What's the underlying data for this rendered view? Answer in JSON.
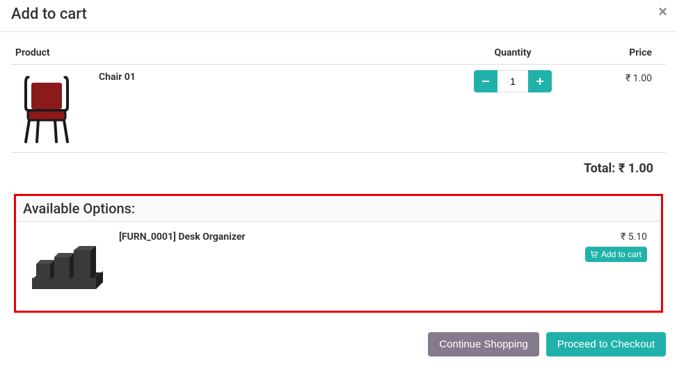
{
  "modal": {
    "title": "Add to cart",
    "close": "×"
  },
  "table_headers": {
    "product": "Product",
    "quantity": "Quantity",
    "price": "Price"
  },
  "cart_items": [
    {
      "name": "Chair 01",
      "quantity": "1",
      "price": "₹ 1.00"
    }
  ],
  "total": {
    "label": "Total:",
    "value": "₹ 1.00"
  },
  "available": {
    "title": "Available Options:",
    "items": [
      {
        "name": "[FURN_0001] Desk Organizer",
        "price": "₹ 5.10",
        "add_label": "Add to cart"
      }
    ]
  },
  "footer": {
    "continue": "Continue Shopping",
    "checkout": "Proceed to Checkout"
  }
}
